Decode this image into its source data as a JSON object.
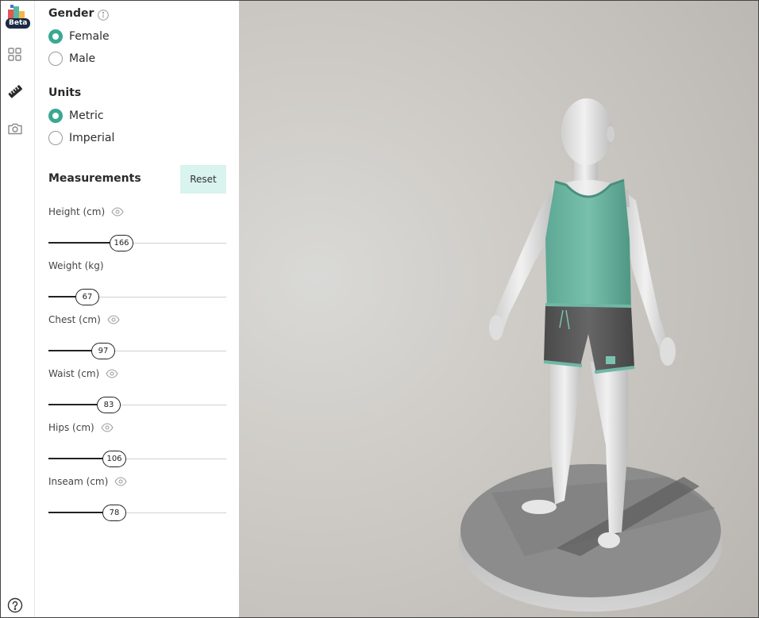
{
  "sidebar": {
    "beta_badge": "Beta",
    "icons": [
      "grid-icon",
      "ruler-icon",
      "camera-icon"
    ],
    "help_icon": "help-icon"
  },
  "gender": {
    "title": "Gender",
    "options": [
      {
        "label": "Female",
        "checked": true
      },
      {
        "label": "Male",
        "checked": false
      }
    ]
  },
  "units": {
    "title": "Units",
    "options": [
      {
        "label": "Metric",
        "checked": true
      },
      {
        "label": "Imperial",
        "checked": false
      }
    ]
  },
  "measurements": {
    "title": "Measurements",
    "reset_label": "Reset",
    "items": [
      {
        "label": "Height (cm)",
        "value": "166",
        "fraction": 0.41,
        "eye": true
      },
      {
        "label": "Weight (kg)",
        "value": "67",
        "fraction": 0.22,
        "eye": false
      },
      {
        "label": "Chest (cm)",
        "value": "97",
        "fraction": 0.31,
        "eye": true
      },
      {
        "label": "Waist (cm)",
        "value": "83",
        "fraction": 0.34,
        "eye": true
      },
      {
        "label": "Hips (cm)",
        "value": "106",
        "fraction": 0.37,
        "eye": true
      },
      {
        "label": "Inseam (cm)",
        "value": "78",
        "fraction": 0.37,
        "eye": true
      }
    ]
  },
  "colors": {
    "accent": "#3aa893",
    "reset_bg": "#d9f3ee",
    "tank_top": "#6fb8a5",
    "shorts": "#5a5a5a",
    "skin": "#e8e8e8"
  }
}
